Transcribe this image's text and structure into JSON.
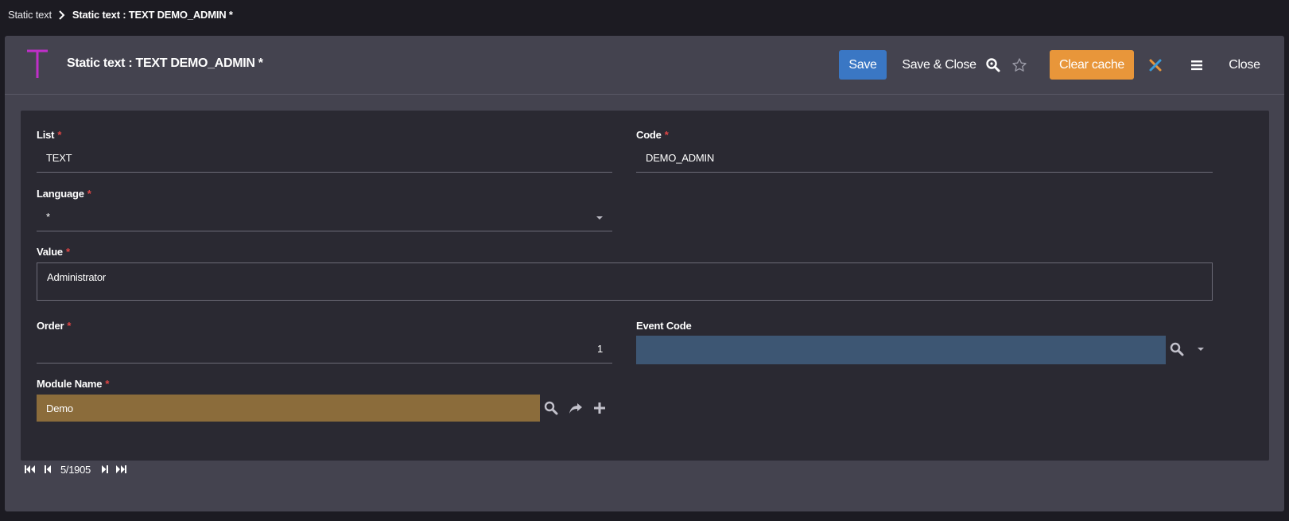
{
  "breadcrumb": {
    "parent": "Static text",
    "current": "Static text : TEXT DEMO_ADMIN *"
  },
  "header": {
    "title": "Static text : TEXT DEMO_ADMIN *",
    "app_icon": "letter-t-icon"
  },
  "toolbar": {
    "save_label": "Save",
    "save_close_label": "Save & Close",
    "clear_cache_label": "Clear cache",
    "close_label": "Close",
    "icons": [
      "zoom-search-icon",
      "star-icon",
      "tools-icon",
      "menu-icon"
    ]
  },
  "form": {
    "list": {
      "label": "List",
      "required": "*",
      "value": "TEXT"
    },
    "code": {
      "label": "Code",
      "required": "*",
      "value": "DEMO_ADMIN"
    },
    "language": {
      "label": "Language",
      "required": "*",
      "value": "*"
    },
    "value": {
      "label": "Value",
      "required": "*",
      "value": "Administrator"
    },
    "order": {
      "label": "Order",
      "required": "*",
      "value": "1"
    },
    "event_code": {
      "label": "Event Code",
      "value": ""
    },
    "module_name": {
      "label": "Module Name",
      "required": "*",
      "value": "Demo"
    }
  },
  "pager": {
    "position": "5/1905"
  },
  "colors": {
    "page_bg": "#1c1b22",
    "panel_bg": "#44434f",
    "form_bg": "#2a2932",
    "save_button": "#3a77c4",
    "clear_cache_button": "#e8963a",
    "event_code_field": "#3d5673",
    "module_name_field": "#8b6c3b",
    "app_icon": "#c02fc9",
    "required_mark": "#e04545"
  }
}
